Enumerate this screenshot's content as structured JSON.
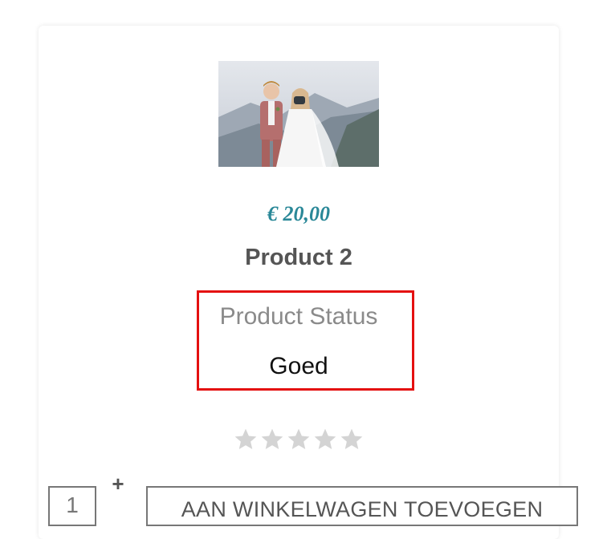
{
  "product": {
    "image_alt": "Bride and groom photo",
    "price": "€ 20,00",
    "title": "Product 2",
    "status_label": "Product Status",
    "status_value": "Goed",
    "rating": 0,
    "rating_max": 5
  },
  "cart": {
    "quantity": "1",
    "plus_label": "+",
    "add_button_label": "AAN WINKELWAGEN TOEVOEGEN"
  },
  "colors": {
    "price": "#2a8898",
    "highlight_border": "#e41010",
    "star_empty": "#d4d4d4"
  },
  "icons": {
    "star": "star-icon"
  }
}
